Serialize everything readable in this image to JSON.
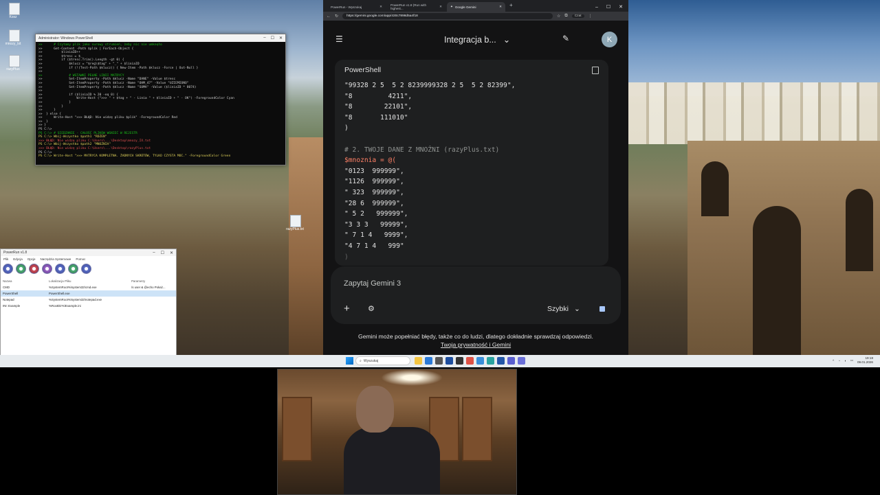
{
  "desktop": {
    "icons": [
      {
        "label": "Kosz"
      },
      {
        "label": "mnozy_txt"
      },
      {
        "label": "razyPlus"
      },
      {
        "label": "razyPlus.txt"
      }
    ]
  },
  "powershell": {
    "title": "Administrator: Windows PowerShell",
    "lines": [
      {
        "text": ">>      # Czytamy plik jako surowy strumień, żeby nic nie umknęło",
        "cls": "c-green"
      },
      {
        "text": ">>      Get-Content -Path $plik | ForEach-Object {",
        "cls": ""
      },
      {
        "text": ">>          $liniaID++",
        "cls": ""
      },
      {
        "text": ">>          $tresc = $_",
        "cls": ""
      },
      {
        "text": ">>          if ($tresc.Trim().Length -gt 0) {",
        "cls": ""
      },
      {
        "text": ">>              $klucz = \"$reg\\$tag\" + \"_\" + $liniaID",
        "cls": ""
      },
      {
        "text": ">>              if (!(Test-Path $klucz)) { New-Item -Path $klucz -Force | Out-Null }",
        "cls": ""
      },
      {
        "text": ">>",
        "cls": ""
      },
      {
        "text": ">>              # WSTAWKI PEŁNE LINII MATRYCY",
        "cls": "c-green"
      },
      {
        "text": ">>              Set-ItemProperty -Path $klucz -Name \"DANE\" -Value $tresc",
        "cls": ""
      },
      {
        "text": ">>              Set-ItemProperty -Path $klucz -Name \"OHM_47\" -Value \"UZIEMIONO\"",
        "cls": ""
      },
      {
        "text": ">>              Set-ItemProperty -Path $klucz -Name \"SUMA\" -Value ($liniaID * 8074)",
        "cls": ""
      },
      {
        "text": ">>",
        "cls": ""
      },
      {
        "text": ">>              if ($liniaID % 20 -eq 0) {",
        "cls": ""
      },
      {
        "text": ">>                  Write-Host (\">>> \" + $tag + \" - Linia \" + $liniaID + \" - OK\") -ForegroundColor Cyan",
        "cls": ""
      },
      {
        "text": ">>              }",
        "cls": ""
      },
      {
        "text": ">>          }",
        "cls": ""
      },
      {
        "text": ">>      }",
        "cls": ""
      },
      {
        "text": ">>  } else {",
        "cls": ""
      },
      {
        "text": ">>      Write-Host \">>> BŁĄD: Nie widzę pliku $plik\" -ForegroundColor Red",
        "cls": ""
      },
      {
        "text": ">>  }",
        "cls": ""
      },
      {
        "text": ">> }",
        "cls": ""
      },
      {
        "text": "PS C:\\>",
        "cls": ""
      },
      {
        "text": "PS C:\\> # SIEDZANIE - CAŁOŚĆ PLIKÓW WGNIEĆ W REJESTR",
        "cls": "c-green"
      },
      {
        "text": "PS C:\\> Wbij-Wszystko $path1 \"RDZEN\"",
        "cls": "c-yellow"
      },
      {
        "text": ">>> BŁĄD: Nie widzę pliku C:\\Users\\...\\Desktop\\mnozy_IX.txt",
        "cls": "c-red"
      },
      {
        "text": "PS C:\\> Wbij-Wszystko $path2 \"MNOZNIA\"",
        "cls": "c-yellow"
      },
      {
        "text": ">>> BŁĄD: Nie widzę pliku C:\\Users\\...\\Desktop\\razyPlus.txt",
        "cls": "c-red"
      },
      {
        "text": "PS C:\\>",
        "cls": ""
      },
      {
        "text": "PS C:\\> Write-Host \">>> MATRYCA KOMPLETNA. ŻADNYCH SKRÓTÓW, TYLKO CZYSTA MOC.\" -ForegroundColor Green",
        "cls": "c-yellow"
      }
    ]
  },
  "launcher": {
    "title": "PowerRun v1.8",
    "menu": [
      "Plik",
      "Edycja",
      "Opcje",
      "Narzędzia Systemowe",
      "Pomoc"
    ],
    "columns": [
      "Nazwa",
      "Lokalizacja Pliku",
      "Parametry"
    ],
    "rows": [
      {
        "name": "CMD",
        "path": "%SystemRoot%\\system32\\cmd.exe",
        "params": "/s user & @echo Pokaż...",
        "selected": false
      },
      {
        "name": "PowerShell",
        "path": "PowerShell.exe",
        "params": "",
        "selected": true
      },
      {
        "name": "Notepad",
        "path": "%SystemRoot%\\system32\\notepad.exe",
        "params": "",
        "selected": false
      },
      {
        "name": "INI: Example",
        "path": "%RootDir%\\Example.ini",
        "params": "",
        "selected": false
      }
    ]
  },
  "browser": {
    "tabs": [
      {
        "label": "PowerRun - Wyszukaj",
        "active": false
      },
      {
        "label": "PowerRun v1.8 (Run with highest...",
        "active": false
      },
      {
        "label": "Google Gemini",
        "active": true
      }
    ],
    "url": "https://gemini.google.com/app/430c7898d5a4f18",
    "profile": "Czat"
  },
  "gemini": {
    "conversation_title": "Integracja b...",
    "avatar_letter": "K",
    "code_language": "PowerShell",
    "code_lines": [
      {
        "text": "\"99328 2 5  5 2 8239999328 2 5  5 2 82399\",",
        "cls": ""
      },
      {
        "text": "\"8         4211\",",
        "cls": ""
      },
      {
        "text": "\"8        22101\",",
        "cls": ""
      },
      {
        "text": "\"8       111010\"",
        "cls": ""
      },
      {
        "text": ")",
        "cls": ""
      },
      {
        "text": "",
        "cls": ""
      },
      {
        "text": "# 2. TWOJE DANE Z MNOŻNI (razyPlus.txt)",
        "cls": "cm"
      },
      {
        "text": "$mnoznia = @(",
        "cls": "var"
      },
      {
        "text": "\"0123  999999\",",
        "cls": ""
      },
      {
        "text": "\"1126  999999\",",
        "cls": ""
      },
      {
        "text": "\" 323  999999\",",
        "cls": ""
      },
      {
        "text": "\"28 6  999999\",",
        "cls": ""
      },
      {
        "text": "\" 5 2   999999\",",
        "cls": ""
      },
      {
        "text": "\"3 3 3   99999\",",
        "cls": ""
      },
      {
        "text": "\" 7 1 4   9999\",",
        "cls": ""
      },
      {
        "text": "\"4 7 1 4   999\"",
        "cls": ""
      },
      {
        "text": ")",
        "cls": "fade"
      }
    ],
    "prompt_placeholder": "Zapytaj Gemini 3",
    "mode_label": "Szybki",
    "disclaimer": "Gemini może popełniać błędy, także co do ludzi, dlatego dokładnie sprawdzaj odpowiedzi.",
    "privacy_link": "Twoja prywatność i Gemini"
  },
  "taskbar": {
    "search_placeholder": "Wyszukaj",
    "time": "19:18",
    "date": "09.01.2026"
  }
}
